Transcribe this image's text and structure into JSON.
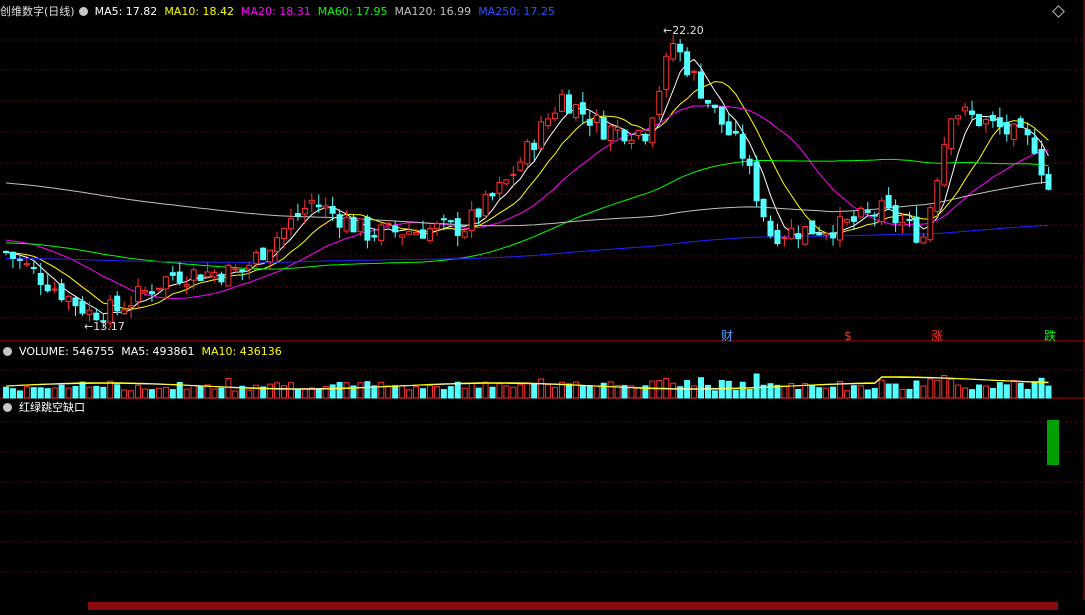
{
  "main_header": {
    "title": "创维数字(日线)",
    "ma5": "MA5: 17.82",
    "ma10": "MA10: 18.42",
    "ma20": "MA20: 18.31",
    "ma60": "MA60: 17.95",
    "ma120": "MA120: 16.99",
    "ma250": "MA250: 17.25"
  },
  "volume_header": {
    "title": "VOLUME: 546755",
    "ma5": "MA5: 493861",
    "ma10": "MA10: 436136"
  },
  "indicator_header": {
    "title": "红绿跳空缺口"
  },
  "colors": {
    "up": "#ff3232",
    "down": "#54ffff",
    "ma5": "#ffffff",
    "ma10": "#ffff00",
    "ma20": "#ff00ff",
    "ma60": "#00ff00",
    "ma120": "#c0c0c0",
    "ma250": "#2222ff",
    "grid": "#6e0000",
    "separator": "#b40000",
    "gap_bar": "#00a000"
  },
  "chart_data": [
    {
      "type": "candlestick",
      "title": "创维数字(日线)",
      "price_range": [
        12.4,
        22.8
      ],
      "high_label": "22.20",
      "low_label": "13.17",
      "event_markers": [
        {
          "label": "财",
          "color": "#58a0ff"
        },
        {
          "label": "$",
          "color": "#ff3030"
        },
        {
          "label": "涨",
          "color": "#ff3030"
        },
        {
          "label": "跌",
          "color": "#00ff00"
        }
      ],
      "note": "Main-panel candlesticks, moving averages and volume bars are generated procedurally in the drawing script as an approximation of the screenshot."
    },
    {
      "type": "bar",
      "title": "VOLUME: 546755",
      "last_volume": 546755,
      "ma5": 493861,
      "ma10": 436136
    },
    {
      "type": "bar",
      "title": "红绿跳空缺口",
      "series": [
        {
          "name": "红绿跳空缺口",
          "values": [
            -1
          ]
        }
      ]
    }
  ]
}
